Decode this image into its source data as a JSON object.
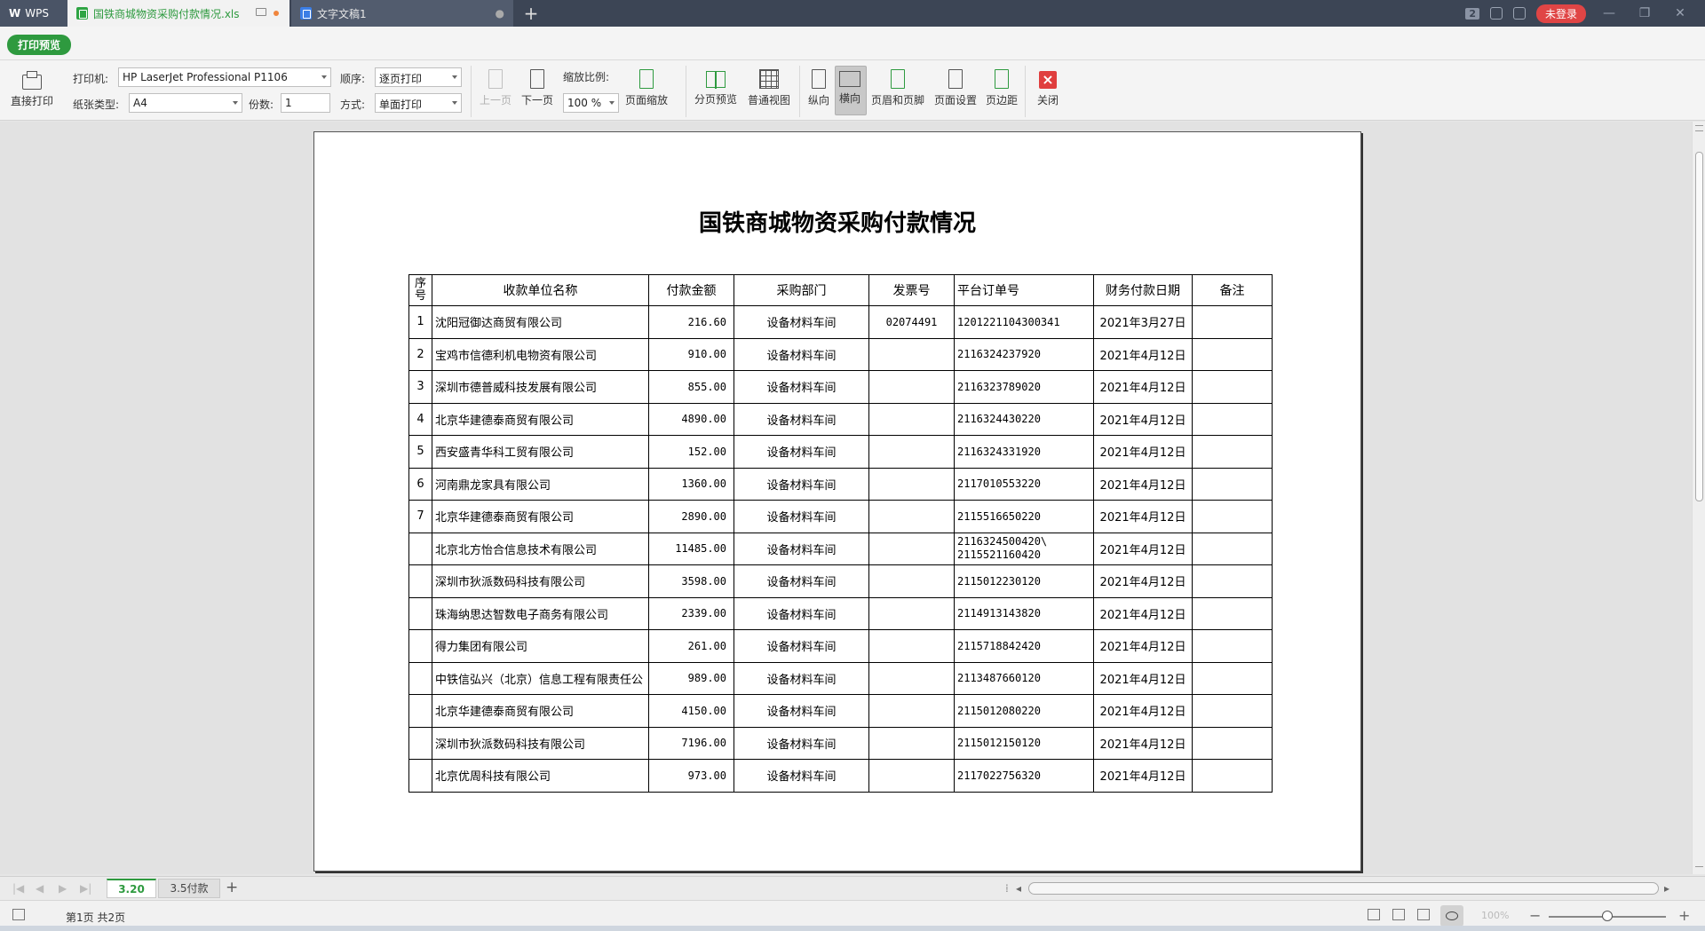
{
  "tabbar": {
    "wps_label": "WPS",
    "tabs": [
      {
        "label": "国铁商城物资采购付款情况.xls",
        "type": "spreadsheet"
      },
      {
        "label": "文字文稿1",
        "type": "writer"
      }
    ],
    "add_tab": "+",
    "count_badge": "2",
    "login_label": "未登录"
  },
  "header": {
    "print_preview_label": "打印预览"
  },
  "toolbar": {
    "direct_print": "直接打印",
    "printer_label": "打印机:",
    "printer_value": "HP LaserJet Professional P1106",
    "paper_label": "纸张类型:",
    "paper_value": "A4",
    "order_label": "顺序:",
    "order_value": "逐页打印",
    "copies_label": "份数:",
    "copies_value": "1",
    "mode_label": "方式:",
    "mode_value": "单面打印",
    "prev_page": "上一页",
    "next_page": "下一页",
    "zoom_label": "缩放比例:",
    "zoom_value": "100 %",
    "page_zoom": "页面缩放",
    "page_break_preview": "分页预览",
    "normal_view": "普通视图",
    "portrait": "纵向",
    "landscape": "横向",
    "header_footer": "页眉和页脚",
    "page_setup": "页面设置",
    "margins": "页边距",
    "close": "关闭"
  },
  "document": {
    "title": "国铁商城物资采购付款情况",
    "headers": [
      "序号",
      "收款单位名称",
      "付款金额",
      "采购部门",
      "发票号",
      "平台订单号",
      "财务付款日期",
      "备注"
    ],
    "rows": [
      [
        "1",
        "沈阳冠御达商贸有限公司",
        "216.60",
        "设备材料车间",
        "02074491",
        "1201221104300341",
        "2021年3月27日",
        ""
      ],
      [
        "2",
        "宝鸡市信德利机电物资有限公司",
        "910.00",
        "设备材料车间",
        "",
        "2116324237920",
        "2021年4月12日",
        ""
      ],
      [
        "3",
        "深圳市德普威科技发展有限公司",
        "855.00",
        "设备材料车间",
        "",
        "2116323789020",
        "2021年4月12日",
        ""
      ],
      [
        "4",
        "北京华建德泰商贸有限公司",
        "4890.00",
        "设备材料车间",
        "",
        "2116324430220",
        "2021年4月12日",
        ""
      ],
      [
        "5",
        "西安盛青华科工贸有限公司",
        "152.00",
        "设备材料车间",
        "",
        "2116324331920",
        "2021年4月12日",
        ""
      ],
      [
        "6",
        "河南鼎龙家具有限公司",
        "1360.00",
        "设备材料车间",
        "",
        "2117010553220",
        "2021年4月12日",
        ""
      ],
      [
        "7",
        "北京华建德泰商贸有限公司",
        "2890.00",
        "设备材料车间",
        "",
        "2115516650220",
        "2021年4月12日",
        ""
      ],
      [
        "",
        "北京北方怡合信息技术有限公司",
        "11485.00",
        "设备材料车间",
        "",
        "2116324500420\\ 2115521160420",
        "2021年4月12日",
        ""
      ],
      [
        "",
        "深圳市狄派数码科技有限公司",
        "3598.00",
        "设备材料车间",
        "",
        "2115012230120",
        "2021年4月12日",
        ""
      ],
      [
        "",
        "珠海纳思达智数电子商务有限公司",
        "2339.00",
        "设备材料车间",
        "",
        "2114913143820",
        "2021年4月12日",
        ""
      ],
      [
        "",
        "得力集团有限公司",
        "261.00",
        "设备材料车间",
        "",
        "2115718842420",
        "2021年4月12日",
        ""
      ],
      [
        "",
        "中铁信弘兴（北京）信息工程有限责任公",
        "989.00",
        "设备材料车间",
        "",
        "2113487660120",
        "2021年4月12日",
        ""
      ],
      [
        "",
        "北京华建德泰商贸有限公司",
        "4150.00",
        "设备材料车间",
        "",
        "2115012080220",
        "2021年4月12日",
        ""
      ],
      [
        "",
        "深圳市狄派数码科技有限公司",
        "7196.00",
        "设备材料车间",
        "",
        "2115012150120",
        "2021年4月12日",
        ""
      ],
      [
        "",
        "北京优周科技有限公司",
        "973.00",
        "设备材料车间",
        "",
        "2117022756320",
        "2021年4月12日",
        ""
      ]
    ]
  },
  "sheets": [
    {
      "label": "3.20",
      "active": true
    },
    {
      "label": "3.5付款",
      "active": false
    }
  ],
  "statusbar": {
    "page_info": "第1页 共2页",
    "zoom_percent": "100%",
    "zoom_level": 0.5
  },
  "colors": {
    "accent_green": "#2e9a3f",
    "tabbar_bg": "#3c4555",
    "login_red": "#e04545",
    "close_red": "#e03e3e"
  }
}
